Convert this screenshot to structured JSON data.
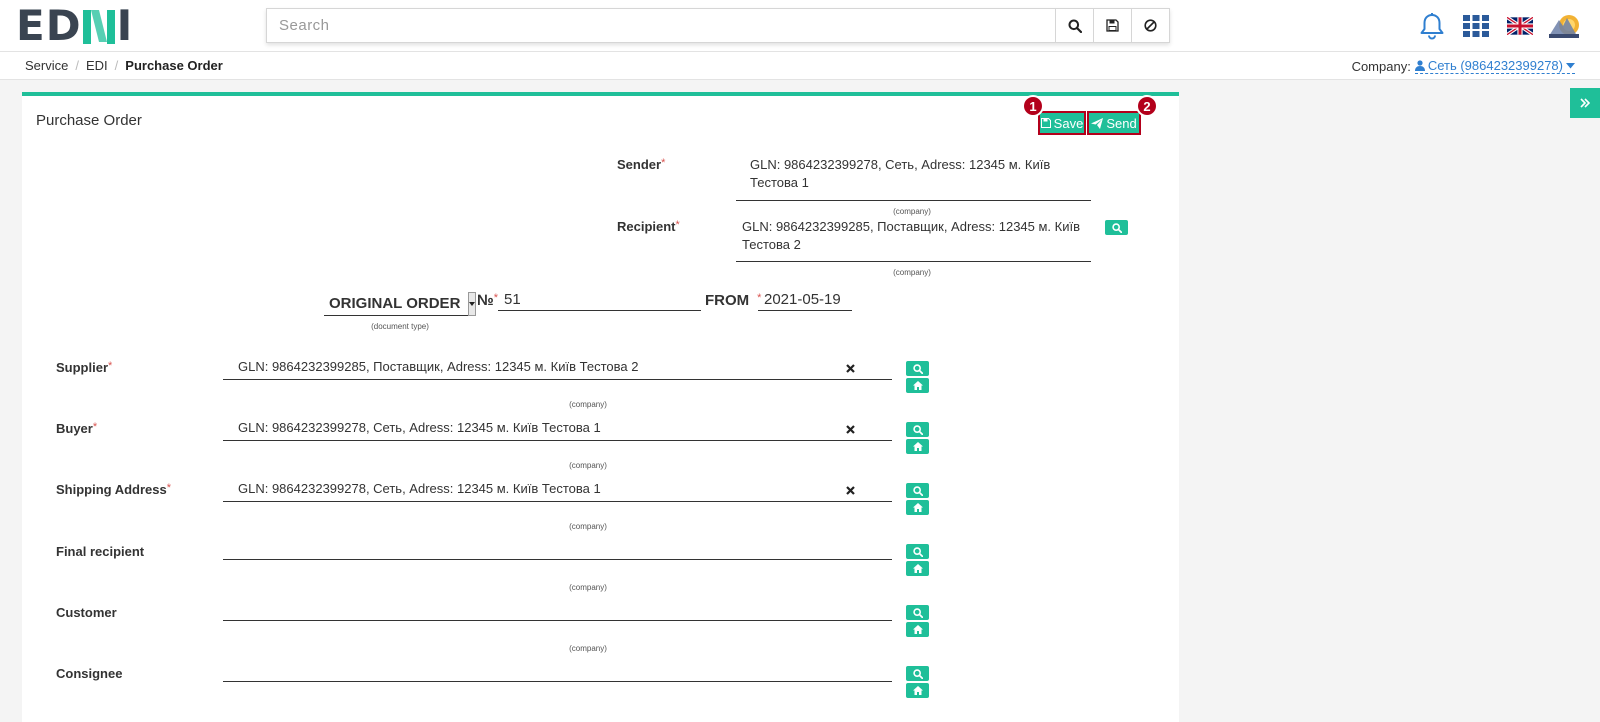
{
  "app": {
    "logo_dark": "ED",
    "logo_green": "N",
    "logo_tail": "I"
  },
  "search": {
    "placeholder": "Search"
  },
  "breadcrumb": {
    "items": [
      "Service",
      "EDI"
    ],
    "current": "Purchase Order"
  },
  "company": {
    "label": "Company:",
    "value": "Сеть (9864232399278)"
  },
  "card": {
    "title": "Purchase Order",
    "save_label": "Save",
    "send_label": "Send",
    "badge_1": "1",
    "badge_2": "2"
  },
  "header_parties": {
    "sender_label": "Sender",
    "sender_value_l1": "GLN: 9864232399278, Сеть, Adress: 12345 м. Київ",
    "sender_value_l2": "Тестова 1",
    "recipient_label": "Recipient",
    "recipient_value_l1": "GLN: 9864232399285, Поставщик, Adress: 12345 м. Київ",
    "recipient_value_l2": "Тестова 2",
    "company_caption": "(company)"
  },
  "doc": {
    "type_value": "ORIGINAL ORDER",
    "type_caption": "(document type)",
    "number_label": "№",
    "number_value": "51",
    "from_label": "FROM",
    "date_value": "2021-05-19"
  },
  "fields": [
    {
      "label": "Supplier",
      "required": true,
      "value": "GLN: 9864232399285, Поставщик, Adress: 12345 м. Київ Тестова 2",
      "caption": "(company)"
    },
    {
      "label": "Buyer",
      "required": true,
      "value": "GLN: 9864232399278, Сеть, Adress: 12345 м. Київ Тестова 1",
      "caption": "(company)"
    },
    {
      "label": "Shipping Address",
      "required": true,
      "value": "GLN: 9864232399278, Сеть, Adress: 12345 м. Київ Тестова 1",
      "caption": "(company)"
    },
    {
      "label": "Final recipient",
      "required": false,
      "value": "",
      "caption": "(company)"
    },
    {
      "label": "Customer",
      "required": false,
      "value": "",
      "caption": "(company)"
    },
    {
      "label": "Consignee",
      "required": false,
      "value": "",
      "caption": ""
    }
  ],
  "required_mark": "*",
  "colors": {
    "accent": "#1fbf99",
    "danger": "#b3001b",
    "link": "#2f7fd0"
  }
}
